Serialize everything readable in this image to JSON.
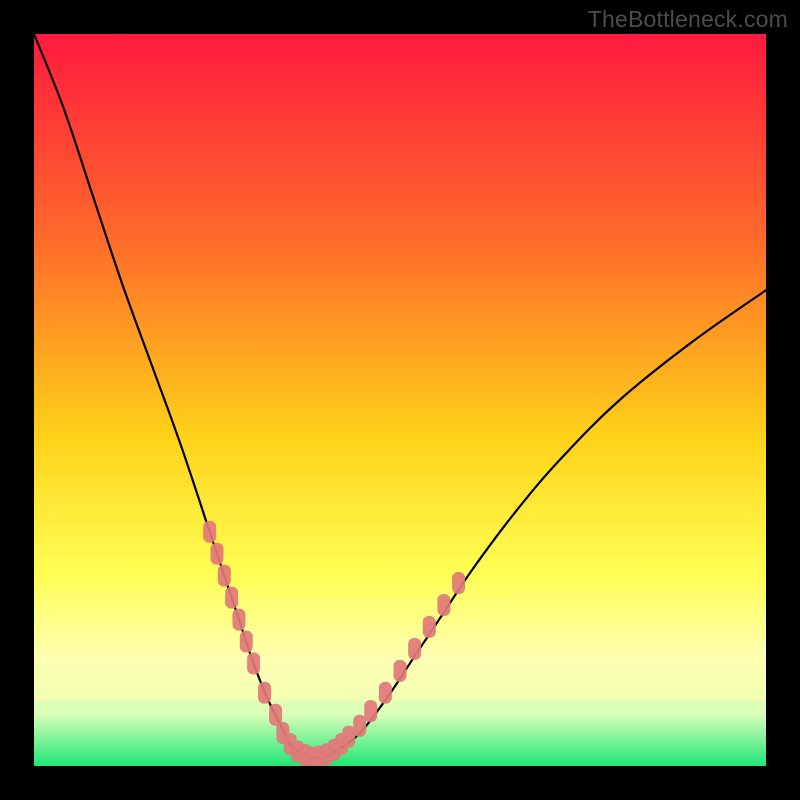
{
  "watermark": "TheBottleneck.com",
  "colors": {
    "bg": "#000000",
    "grad_top": "#ff1a3f",
    "grad_mid1": "#ff6a2a",
    "grad_mid2": "#ffd21a",
    "grad_mid3": "#ffff55",
    "grad_pale": "#ffffb0",
    "grad_bottom_light": "#d8ffb8",
    "grad_bottom": "#1de676",
    "curve": "#000000",
    "marker": "#e27878"
  },
  "chart_data": {
    "type": "line",
    "title": "",
    "xlabel": "",
    "ylabel": "",
    "xlim": [
      0,
      100
    ],
    "ylim": [
      0,
      100
    ],
    "series": [
      {
        "name": "bottleneck-curve",
        "x": [
          0,
          4,
          8,
          12,
          16,
          20,
          24,
          26,
          28,
          30,
          32,
          34,
          35,
          36,
          38,
          40,
          44,
          48,
          52,
          56,
          60,
          66,
          72,
          80,
          90,
          100
        ],
        "y": [
          100,
          90,
          78,
          66,
          55,
          44,
          32,
          26,
          20,
          14,
          9,
          5,
          3,
          2,
          1.2,
          1.4,
          4,
          9,
          15,
          21,
          27,
          35,
          42,
          50,
          58,
          65
        ]
      }
    ],
    "markers": [
      {
        "x": 24,
        "y": 32
      },
      {
        "x": 25,
        "y": 29
      },
      {
        "x": 26,
        "y": 26
      },
      {
        "x": 27,
        "y": 23
      },
      {
        "x": 28,
        "y": 20
      },
      {
        "x": 29,
        "y": 17
      },
      {
        "x": 30,
        "y": 14
      },
      {
        "x": 31.5,
        "y": 10
      },
      {
        "x": 33,
        "y": 7
      },
      {
        "x": 34,
        "y": 4.5
      },
      {
        "x": 35,
        "y": 3
      },
      {
        "x": 36,
        "y": 2
      },
      {
        "x": 37,
        "y": 1.5
      },
      {
        "x": 38,
        "y": 1.2
      },
      {
        "x": 39,
        "y": 1.3
      },
      {
        "x": 40,
        "y": 1.6
      },
      {
        "x": 41,
        "y": 2.2
      },
      {
        "x": 42,
        "y": 3
      },
      {
        "x": 43,
        "y": 4
      },
      {
        "x": 44.5,
        "y": 5.5
      },
      {
        "x": 46,
        "y": 7.5
      },
      {
        "x": 48,
        "y": 10
      },
      {
        "x": 50,
        "y": 13
      },
      {
        "x": 52,
        "y": 16
      },
      {
        "x": 54,
        "y": 19
      },
      {
        "x": 56,
        "y": 22
      },
      {
        "x": 58,
        "y": 25
      }
    ]
  }
}
